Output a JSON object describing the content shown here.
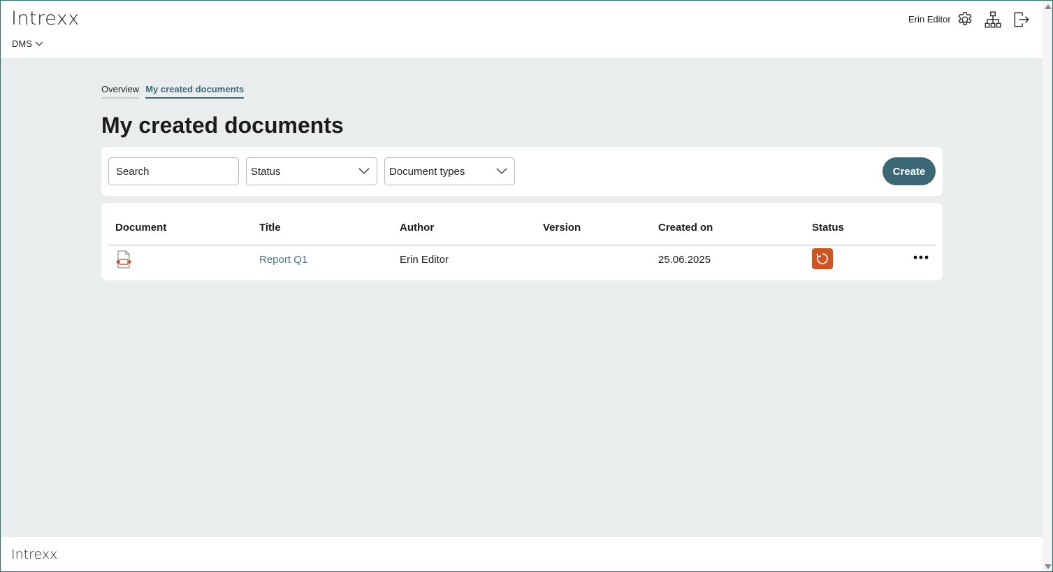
{
  "header": {
    "logo": "Intrexx",
    "app_menu_label": "DMS",
    "user_name": "Erin Editor",
    "icons": [
      "gear-icon",
      "sitemap-icon",
      "logout-icon"
    ]
  },
  "tabs": [
    {
      "label": "Overview",
      "active": false
    },
    {
      "label": "My created documents",
      "active": true
    }
  ],
  "page_title": "My created documents",
  "filters": {
    "search_placeholder": "Search",
    "status_label": "Status",
    "doc_types_label": "Document types",
    "create_label": "Create"
  },
  "table": {
    "columns": [
      "Document",
      "Title",
      "Author",
      "Version",
      "Created on",
      "Status"
    ],
    "rows": [
      {
        "document_icon": "pdf-file-icon",
        "title": "Report Q1",
        "author": "Erin Editor",
        "version": "",
        "created_on": "25.06.2025",
        "status_icon": "refresh-icon",
        "status_color": "#cb5524"
      }
    ]
  },
  "footer": {
    "logo": "Intrexx"
  },
  "colors": {
    "accent": "#3c6876",
    "background": "#eaedee",
    "status_in_progress": "#cb5524",
    "link": "#4c7080"
  }
}
